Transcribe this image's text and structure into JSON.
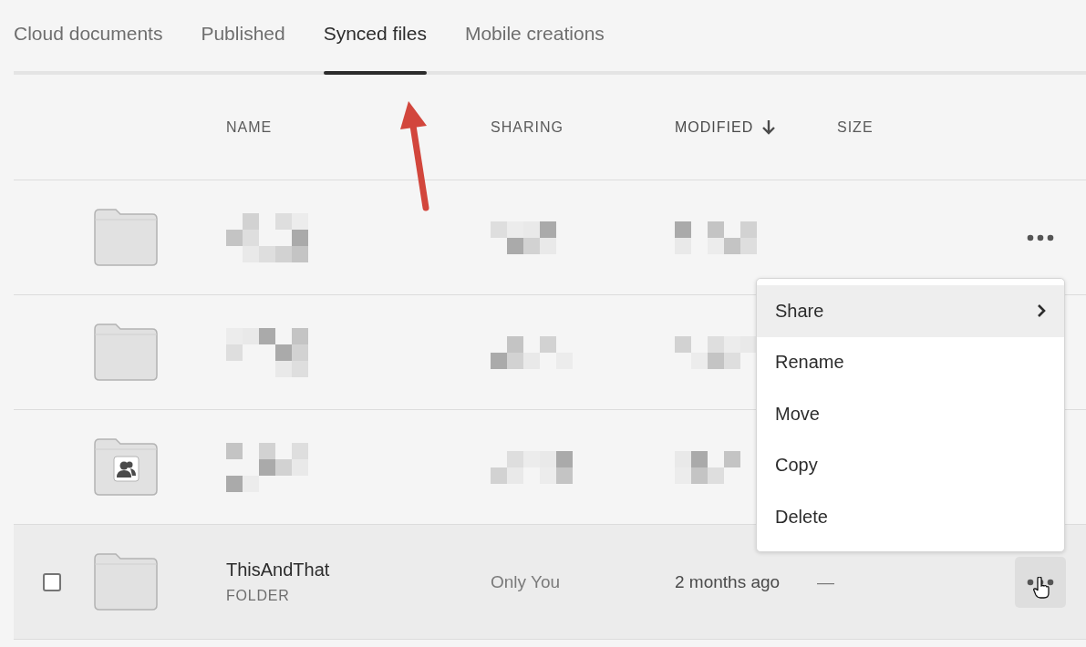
{
  "tabs": [
    {
      "label": "Cloud documents",
      "selected": false
    },
    {
      "label": "Published",
      "selected": false
    },
    {
      "label": "Synced files",
      "selected": true
    },
    {
      "label": "Mobile creations",
      "selected": false
    }
  ],
  "table": {
    "columns": [
      {
        "label": "NAME",
        "sorted": false
      },
      {
        "label": "SHARING",
        "sorted": false
      },
      {
        "label": "MODIFIED",
        "sorted": true
      },
      {
        "label": "SIZE",
        "sorted": false
      }
    ],
    "rows": [
      {
        "kind": "redacted",
        "shared": false,
        "actions_shown": true,
        "hovered": false
      },
      {
        "kind": "redacted",
        "shared": false
      },
      {
        "kind": "redacted",
        "shared": true
      },
      {
        "kind": "item",
        "shared": false,
        "name": "ThisAndThat",
        "type": "FOLDER",
        "sharing": "Only You",
        "modified": "2 months ago",
        "size": "—",
        "checked": false,
        "hovered": true,
        "actions_shown": true
      }
    ]
  },
  "context_menu": {
    "items": [
      {
        "label": "Share",
        "submenu": true,
        "highlighted": true
      },
      {
        "label": "Rename",
        "submenu": false,
        "highlighted": false
      },
      {
        "label": "Move",
        "submenu": false,
        "highlighted": false
      },
      {
        "label": "Copy",
        "submenu": false,
        "highlighted": false
      },
      {
        "label": "Delete",
        "submenu": false,
        "highlighted": false
      }
    ]
  },
  "annotation": {
    "kind": "arrow"
  }
}
